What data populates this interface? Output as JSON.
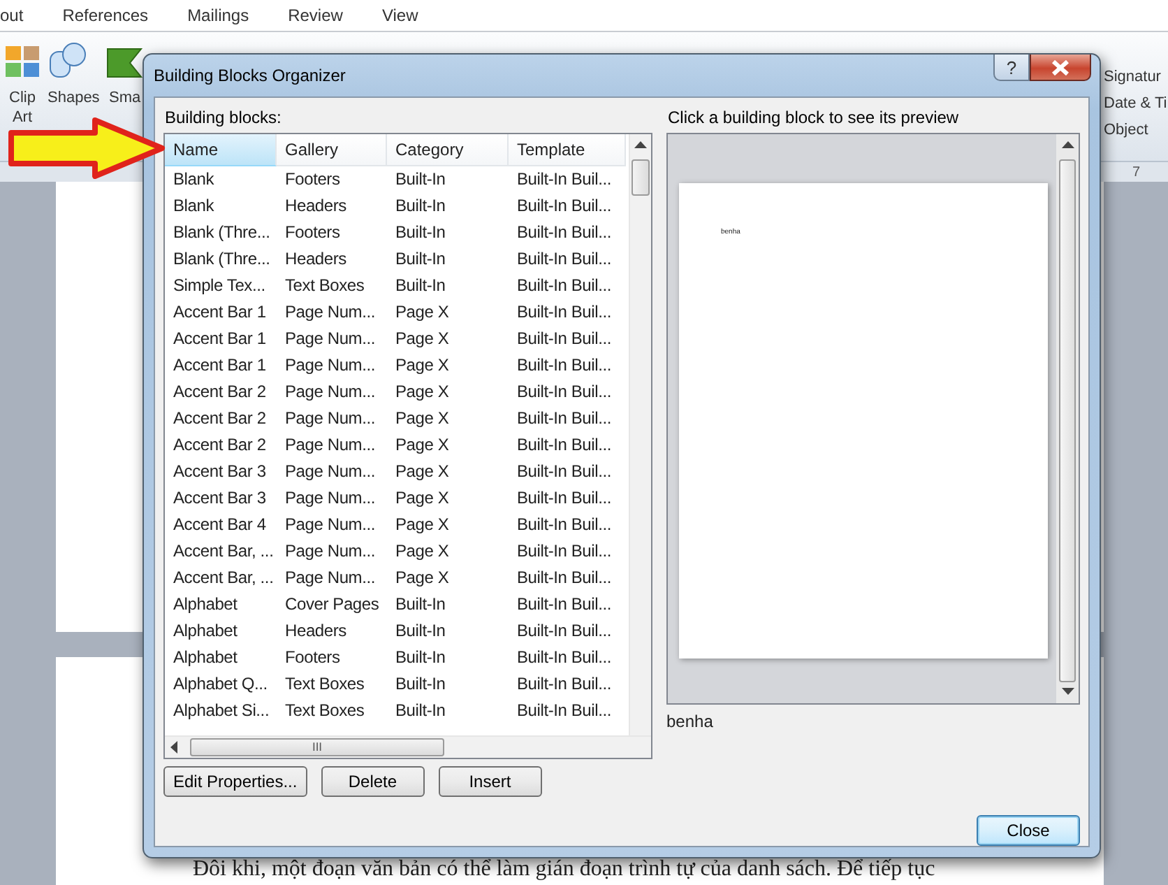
{
  "ribbon": {
    "tabs": [
      "out",
      "References",
      "Mailings",
      "Review",
      "View"
    ],
    "left_buttons": [
      {
        "label": "Clip Art",
        "kind": "clipart"
      },
      {
        "label": "Shapes",
        "kind": "shapes"
      },
      {
        "label": "Sma",
        "kind": "smartart"
      }
    ],
    "right_items": [
      "Signatur",
      "Date & Ti",
      "Object"
    ]
  },
  "ruler_mark": "7",
  "document": {
    "text": "Đôi khi, một đoạn văn bản có thể làm gián đoạn trình tự của danh sách. Để tiếp tục"
  },
  "dialog": {
    "title": "Building Blocks Organizer",
    "help": "?",
    "list_label": "Building blocks:",
    "columns": [
      {
        "label": "Name",
        "selected": true
      },
      {
        "label": "Gallery",
        "selected": false
      },
      {
        "label": "Category",
        "selected": false
      },
      {
        "label": "Template",
        "selected": false
      }
    ],
    "rows": [
      {
        "cells": [
          "Blank",
          "Footers",
          "Built-In",
          "Built-In Buil..."
        ]
      },
      {
        "cells": [
          "Blank",
          "Headers",
          "Built-In",
          "Built-In Buil..."
        ]
      },
      {
        "cells": [
          "Blank (Thre...",
          "Footers",
          "Built-In",
          "Built-In Buil..."
        ]
      },
      {
        "cells": [
          "Blank (Thre...",
          "Headers",
          "Built-In",
          "Built-In Buil..."
        ]
      },
      {
        "cells": [
          "Simple Tex...",
          "Text Boxes",
          "Built-In",
          "Built-In Buil..."
        ]
      },
      {
        "cells": [
          "Accent Bar 1",
          "Page Num...",
          "Page X",
          "Built-In Buil..."
        ]
      },
      {
        "cells": [
          "Accent Bar 1",
          "Page Num...",
          "Page X",
          "Built-In Buil..."
        ]
      },
      {
        "cells": [
          "Accent Bar 1",
          "Page Num...",
          "Page X",
          "Built-In Buil..."
        ]
      },
      {
        "cells": [
          "Accent Bar 2",
          "Page Num...",
          "Page X",
          "Built-In Buil..."
        ]
      },
      {
        "cells": [
          "Accent Bar 2",
          "Page Num...",
          "Page X",
          "Built-In Buil..."
        ]
      },
      {
        "cells": [
          "Accent Bar 2",
          "Page Num...",
          "Page X",
          "Built-In Buil..."
        ]
      },
      {
        "cells": [
          "Accent Bar 3",
          "Page Num...",
          "Page X",
          "Built-In Buil..."
        ]
      },
      {
        "cells": [
          "Accent Bar 3",
          "Page Num...",
          "Page X",
          "Built-In Buil..."
        ]
      },
      {
        "cells": [
          "Accent Bar 4",
          "Page Num...",
          "Page X",
          "Built-In Buil..."
        ]
      },
      {
        "cells": [
          "Accent Bar, ...",
          "Page Num...",
          "Page X",
          "Built-In Buil..."
        ]
      },
      {
        "cells": [
          "Accent Bar, ...",
          "Page Num...",
          "Page X",
          "Built-In Buil..."
        ]
      },
      {
        "cells": [
          "Alphabet",
          "Cover Pages",
          "Built-In",
          "Built-In Buil..."
        ]
      },
      {
        "cells": [
          "Alphabet",
          "Headers",
          "Built-In",
          "Built-In Buil..."
        ]
      },
      {
        "cells": [
          "Alphabet",
          "Footers",
          "Built-In",
          "Built-In Buil..."
        ]
      },
      {
        "cells": [
          "Alphabet Q...",
          "Text Boxes",
          "Built-In",
          "Built-In Buil..."
        ]
      },
      {
        "cells": [
          "Alphabet Si...",
          "Text Boxes",
          "Built-In",
          "Built-In Buil..."
        ]
      }
    ],
    "grip": "III",
    "buttons": [
      "Edit Properties...",
      "Delete",
      "Insert"
    ],
    "preview_label": "Click a building block to see its preview",
    "preview_text": "benha",
    "preview_caption": "benha",
    "close": "Close"
  }
}
